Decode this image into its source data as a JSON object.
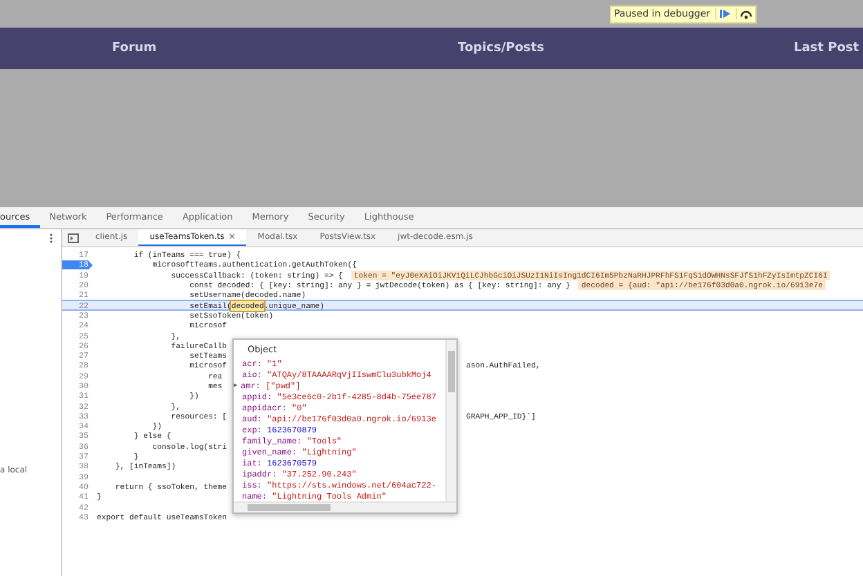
{
  "debugger_badge": {
    "text": "Paused in debugger"
  },
  "nav": [
    {
      "label": "Forum"
    },
    {
      "label": "Topics/Posts"
    },
    {
      "label": "Last Post"
    }
  ],
  "devtools": {
    "tabs": [
      {
        "label": "ources",
        "selected": true
      },
      {
        "label": "Network",
        "selected": false
      },
      {
        "label": "Performance",
        "selected": false
      },
      {
        "label": "Application",
        "selected": false
      },
      {
        "label": "Memory",
        "selected": false
      },
      {
        "label": "Security",
        "selected": false
      },
      {
        "label": "Lighthouse",
        "selected": false
      }
    ],
    "sidebar": {
      "text": "a local"
    },
    "file_tabs": [
      {
        "label": "client.js",
        "selected": false
      },
      {
        "label": "useTeamsToken.ts",
        "selected": true,
        "close": "×"
      },
      {
        "label": "Modal.tsx",
        "selected": false
      },
      {
        "label": "PostsView.tsx",
        "selected": false
      },
      {
        "label": "jwt-decode.esm.js",
        "selected": false
      }
    ],
    "code_lines": [
      {
        "number": "17",
        "text": "        if (inTeams === true) {",
        "breakpoint": false,
        "paused": false
      },
      {
        "number": "18",
        "text": "            microsoftTeams.authentication.getAuthToken({",
        "breakpoint": true,
        "paused": false
      },
      {
        "number": "19",
        "text": "                successCallback: (token: string) => {",
        "inline_value": "token = \"eyJ0eXAiOiJKV1QiLCJhbGciOiJSUzI1NiIsIng1dCI6Im5PbzNaRHJPRFhFS1FqS1dOWHNsSFJfS1hFZyIsImtpZCI6I",
        "breakpoint": false,
        "paused": false
      },
      {
        "number": "20",
        "text": "                    const decoded: { [key: string]: any } = jwtDecode(token) as { [key: string]: any }",
        "inline_value": "decoded = {aud: \"api://be176f03d0a0.ngrok.io/6913e7e",
        "breakpoint": false,
        "paused": false
      },
      {
        "number": "21",
        "text": "                    setUsername(decoded.name)",
        "breakpoint": false,
        "paused": false
      },
      {
        "number": "22",
        "parts": [
          {
            "text": "                    setEmail(",
            "hovered": false
          },
          {
            "text": "decoded",
            "hovered": true
          },
          {
            "text": ".unique_name)",
            "hovered": false
          }
        ],
        "breakpoint": false,
        "paused": true
      },
      {
        "number": "23",
        "text": "                    setSsoToken(token)",
        "breakpoint": false,
        "paused": false
      },
      {
        "number": "24",
        "text": "                    microsof",
        "breakpoint": false,
        "paused": false
      },
      {
        "number": "25",
        "text": "                },",
        "breakpoint": false,
        "paused": false
      },
      {
        "number": "26",
        "text": "                failureCallb",
        "breakpoint": false,
        "paused": false
      },
      {
        "number": "27",
        "text": "                    setTeams",
        "breakpoint": false,
        "paused": false
      },
      {
        "number": "28",
        "text": "                    microsof",
        "right_text": "ason.AuthFailed,",
        "breakpoint": false,
        "paused": false
      },
      {
        "number": "29",
        "text": "                        rea",
        "breakpoint": false,
        "paused": false
      },
      {
        "number": "30",
        "text": "                        mes",
        "breakpoint": false,
        "paused": false
      },
      {
        "number": "31",
        "text": "                    })",
        "breakpoint": false,
        "paused": false
      },
      {
        "number": "32",
        "text": "                },",
        "breakpoint": false,
        "paused": false
      },
      {
        "number": "33",
        "text": "                resources: [",
        "right_text": "GRAPH_APP_ID}`]",
        "breakpoint": false,
        "paused": false
      },
      {
        "number": "34",
        "text": "            })",
        "breakpoint": false,
        "paused": false
      },
      {
        "number": "35",
        "text": "        } else {",
        "breakpoint": false,
        "paused": false
      },
      {
        "number": "36",
        "text": "            console.log(stri",
        "breakpoint": false,
        "paused": false
      },
      {
        "number": "37",
        "text": "        }",
        "breakpoint": false,
        "paused": false
      },
      {
        "number": "38",
        "text": "    }, [inTeams])",
        "breakpoint": false,
        "paused": false
      },
      {
        "number": "39",
        "breakpoint": false,
        "paused": false
      },
      {
        "number": "40",
        "text": "    return { ssoToken, theme",
        "breakpoint": false,
        "paused": false
      },
      {
        "number": "41",
        "text": "}",
        "breakpoint": false,
        "paused": false
      },
      {
        "number": "42",
        "breakpoint": false,
        "paused": false
      },
      {
        "number": "43",
        "text": "export default useTeamsToken",
        "breakpoint": false,
        "paused": false
      }
    ],
    "popover": {
      "title": "Object",
      "properties": [
        {
          "key": "acr:",
          "value": "\"1\"",
          "kind": "string"
        },
        {
          "key": "aio:",
          "value": "\"ATQAy/8TAAAARqVjIIswmClu3ubkMoj4",
          "kind": "string"
        },
        {
          "key": "amr:",
          "value": "[\"pwd\"]",
          "kind": "array",
          "toggle": "▶"
        },
        {
          "key": "appid:",
          "value": "\"5e3ce6c0-2b1f-4285-8d4b-75ee787",
          "kind": "string"
        },
        {
          "key": "appidacr:",
          "value": "\"0\"",
          "kind": "string"
        },
        {
          "key": "aud:",
          "value": "\"api://be176f03d0a0.ngrok.io/6913e",
          "kind": "string"
        },
        {
          "key": "exp:",
          "value": "1623670879",
          "kind": "number"
        },
        {
          "key": "family_name:",
          "value": "\"Tools\"",
          "kind": "string"
        },
        {
          "key": "given_name:",
          "value": "\"Lightning\"",
          "kind": "string"
        },
        {
          "key": "iat:",
          "value": "1623670579",
          "kind": "number"
        },
        {
          "key": "ipaddr:",
          "value": "\"37.252.90.243\"",
          "kind": "string"
        },
        {
          "key": "iss:",
          "value": "\"https://sts.windows.net/604ac722-",
          "kind": "string"
        },
        {
          "key": "name:",
          "value": "\"Lightning Tools Admin\"",
          "kind": "string"
        }
      ]
    }
  }
}
